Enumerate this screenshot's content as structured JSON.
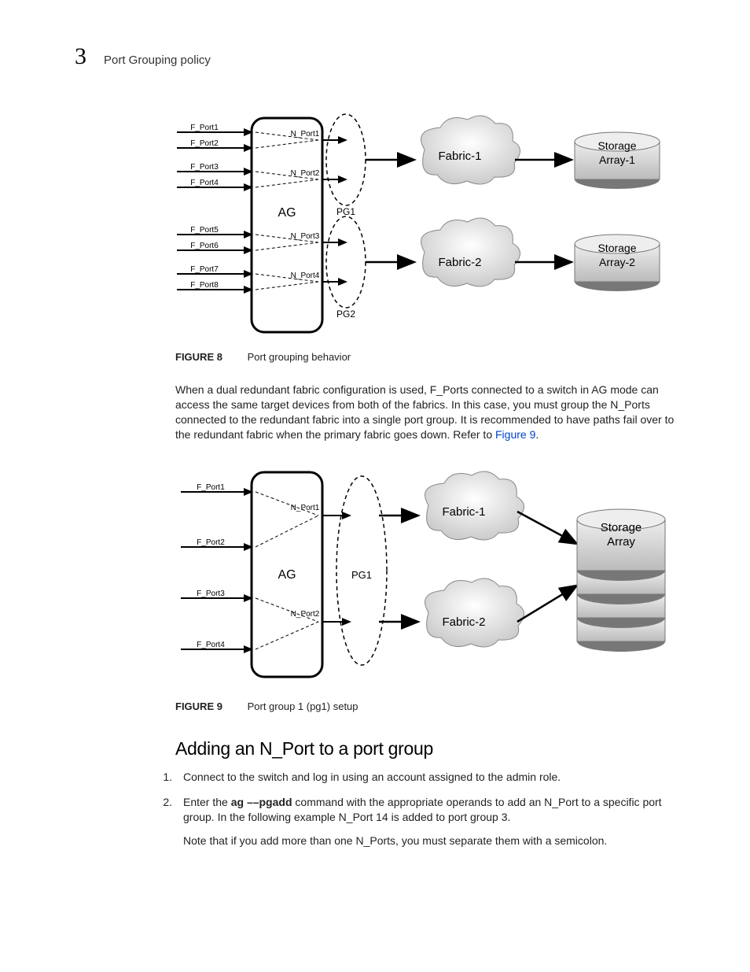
{
  "header": {
    "chapter_num": "3",
    "section_title": "Port Grouping policy"
  },
  "diagram1": {
    "fports": [
      "F_Port1",
      "F_Port2",
      "F_Port3",
      "F_Port4",
      "F_Port5",
      "F_Port6",
      "F_Port7",
      "F_Port8"
    ],
    "nports": [
      "N_Port1",
      "N_Port2",
      "N_Port3",
      "N_Port4"
    ],
    "ag_label": "AG",
    "pg_labels": [
      "PG1",
      "PG2"
    ],
    "fabrics": [
      "Fabric-1",
      "Fabric-2"
    ],
    "storage": [
      "Storage Array-1",
      "Storage Array-2"
    ]
  },
  "figure8": {
    "label": "FIGURE 8",
    "caption": "Port grouping behavior"
  },
  "paragraph1": {
    "text_a": "When a dual redundant fabric configuration is used, F_Ports connected to a switch in AG mode can access the same target devices from both of the fabrics. In this case, you must group the N_Ports connected to the redundant fabric into a single port group. It is recommended to have paths fail over to the redundant fabric when the primary fabric goes down. Refer to ",
    "link": "Figure 9",
    "text_b": "."
  },
  "diagram2": {
    "fports": [
      "F_Port1",
      "F_Port2",
      "F_Port3",
      "F_Port4"
    ],
    "nports": [
      "N_Port1",
      "N_Port2"
    ],
    "ag_label": "AG",
    "pg_label": "PG1",
    "fabrics": [
      "Fabric-1",
      "Fabric-2"
    ],
    "storage": "Storage Array"
  },
  "figure9": {
    "label": "FIGURE 9",
    "caption": "Port group 1 (pg1) setup"
  },
  "heading2": "Adding an N_Port to a port group",
  "steps": {
    "s1": "Connect to the switch and log in using an account assigned to the admin role.",
    "s2_a": "Enter the ",
    "s2_cmd1": "ag ",
    "s2_cmd2": "––pgadd",
    "s2_b": " command with the appropriate operands to add an N_Port to a specific port group. In the following example N_Port 14 is added to port group 3.",
    "s2_note": "Note that if you add more than one N_Ports, you must separate them with a semicolon."
  }
}
